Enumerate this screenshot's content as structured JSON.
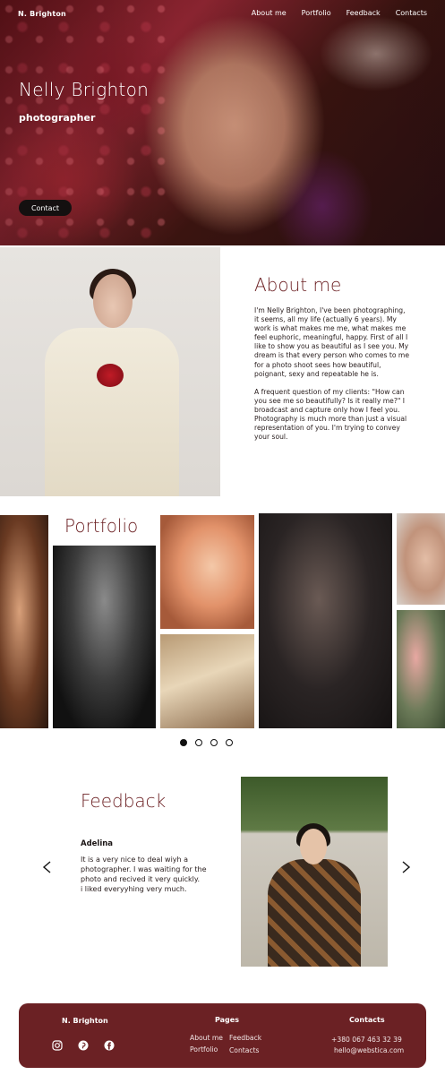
{
  "header": {
    "logo": "N. Brighton",
    "nav": [
      "About me",
      "Portfolio",
      "Feedback",
      "Contacts"
    ]
  },
  "hero": {
    "name": "Nelly Brighton",
    "role": "photographer",
    "button_label": "Contact"
  },
  "about": {
    "title": "About me",
    "paragraphs": [
      "I'm Nelly Brighton, I've been photographing, it seems, all my life (actually 6 years). My work is what makes me me, what makes me feel euphoric, meaningful, happy. First of all I like to show you as beautiful as I see you. My dream is that every person who comes to me for a photo shoot sees how beautiful, poignant, sexy and repeatable he is.",
      "A frequent question of my clients: \"How can you see me so beautifully? Is it really me?\" I broadcast and capture only how I feel you. Photography is much more than just a visual representation of you. I'm trying to convey your soul."
    ]
  },
  "portfolio": {
    "title": "Portfolio",
    "pagination": {
      "count": 4,
      "active": 1
    }
  },
  "feedback": {
    "title": "Feedback",
    "author": "Adelina",
    "text": "It is a very nice to deal wiyh a\nphotographer. I was waiting for the\nphoto and recived it very quickly.\ni liked everyyhing very much.",
    "prev_icon": "chevron-left-icon",
    "next_icon": "chevron-right-icon"
  },
  "footer": {
    "logo": "N. Brighton",
    "socials": [
      "instagram-icon",
      "pinterest-icon",
      "facebook-icon"
    ],
    "pages_title": "Pages",
    "pages": [
      "About me",
      "Feedback",
      "Portfolio",
      "Contacts"
    ],
    "contacts_title": "Contacts",
    "phone": "+380 067 463 32 39",
    "email": "hello@webstica.com"
  },
  "colors": {
    "accent": "#6b1f22",
    "footer_bg": "#6b2124"
  }
}
